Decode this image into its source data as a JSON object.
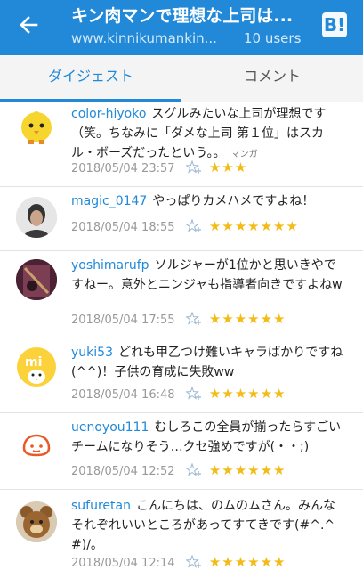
{
  "header": {
    "title": "キン肉マンで理想な上司は...",
    "url": "www.kinnikumankin...",
    "users": "10 users",
    "hatena_icon_text": "B!"
  },
  "tabs": [
    {
      "label": "ダイジェスト",
      "active": true
    },
    {
      "label": "コメント",
      "active": false
    }
  ],
  "comments": [
    {
      "user": "color-hiyoko",
      "text": "スグルみたいな上司が理想です（笑。ちなみに「ダメな上司 第１位」はスカル・ボーズだったという。。",
      "tag": "マンガ",
      "time": "2018/05/04 23:57",
      "stars": "★★★",
      "star_count": 3
    },
    {
      "user": "magic_0147",
      "text": "やっぱりカメハメですよね！",
      "time": "2018/05/04 18:55",
      "stars": "★★★★★★★",
      "star_count": 7
    },
    {
      "user": "yoshimarufp",
      "text": "ソルジャーが1位かと思いきやですねー。意外とニンジャも指導者向きですよねw",
      "time": "2018/05/04 17:55",
      "stars": "★★★★★★",
      "star_count": 6
    },
    {
      "user": "yuki53",
      "text": "どれも甲乙つけ難いキャラばかりですね(^^)！子供の育成に失敗ww",
      "time": "2018/05/04 16:48",
      "stars": "★★★★★★",
      "star_count": 6
    },
    {
      "user": "uenoyou111",
      "text": "むしろこの全員が揃ったらすごいチームになりそう…クセ強めですが(・・;)",
      "time": "2018/05/04 12:52",
      "stars": "★★★★★★",
      "star_count": 6
    },
    {
      "user": "sufuretan",
      "text": "こんにちは、のムのムさん。みんなそれぞれいいところがあってすてきです(#^.^#)/。",
      "time": "2018/05/04 12:14",
      "stars": "★★★★★★",
      "star_count": 6
    }
  ],
  "colors": {
    "accent": "#2189d8",
    "star": "#f2bb16"
  },
  "icons": [
    "back-arrow-icon",
    "hatena-bookmark-icon",
    "add-star-icon"
  ]
}
